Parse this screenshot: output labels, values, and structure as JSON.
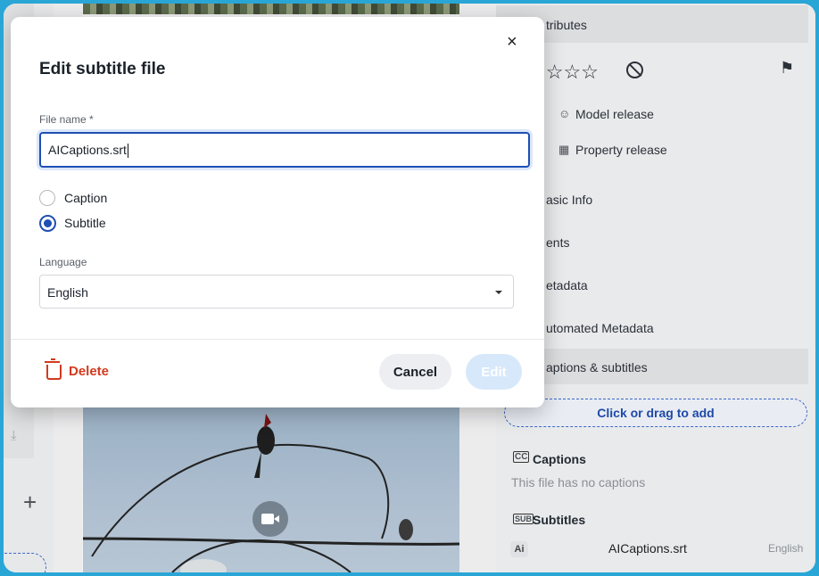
{
  "dialog": {
    "title": "Edit subtitle file",
    "close_icon": "×",
    "file_name_label": "File name *",
    "file_name_value": "AICaptions.srt",
    "type_options": [
      {
        "label": "Caption",
        "selected": false
      },
      {
        "label": "Subtitle",
        "selected": true
      }
    ],
    "language_label": "Language",
    "language_value": "English",
    "delete_label": "Delete",
    "cancel_label": "Cancel",
    "edit_label": "Edit"
  },
  "sidebar": {
    "header": "Attributes",
    "header_visible": "tributes",
    "stars": "☆☆☆☆",
    "flag_icon": "⚑",
    "model_release": "Model release",
    "property_release": "Property release",
    "basic_info": "asic Info",
    "events": "ents",
    "metadata": "etadata",
    "automated_metadata": "utomated Metadata",
    "captions_subtitles": "aptions & subtitles",
    "dropzone": "Click or drag to add",
    "captions_heading": "Captions",
    "captions_empty": "This file has no captions",
    "subtitles_heading": "Subtitles",
    "subtitle_badge": "Ai",
    "subtitle_file": "AICaptions.srt",
    "subtitle_language": "English"
  },
  "left_rail": {
    "plus": "+"
  },
  "colors": {
    "accent": "#1f4fb4",
    "danger": "#d23a1e",
    "frame": "#29a6d6"
  }
}
